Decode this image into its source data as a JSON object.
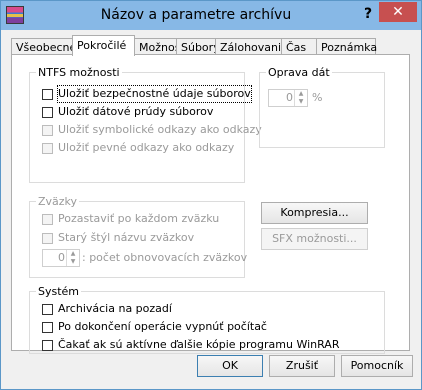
{
  "window": {
    "title": "Názov a parametre archívu",
    "help_glyph": "?",
    "close_glyph": "✕"
  },
  "tabs": [
    {
      "label": "Všeobecné"
    },
    {
      "label": "Pokročilé"
    },
    {
      "label": "Možnosti"
    },
    {
      "label": "Súbory"
    },
    {
      "label": "Zálohovanie"
    },
    {
      "label": "Čas"
    },
    {
      "label": "Poznámka"
    }
  ],
  "ntfs": {
    "title": "NTFS možnosti",
    "options": [
      {
        "label": "Uložiť bezpečnostné údaje súborov",
        "checked": false,
        "enabled": true
      },
      {
        "label": "Uložiť dátové prúdy súborov",
        "checked": false,
        "enabled": true
      },
      {
        "label": "Uložiť symbolické odkazy ako odkazy",
        "checked": false,
        "enabled": false
      },
      {
        "label": "Uložiť pevné odkazy ako odkazy",
        "checked": false,
        "enabled": false
      }
    ]
  },
  "recovery": {
    "title": "Oprava dát",
    "value": "0",
    "unit": "%"
  },
  "volumes": {
    "title": "Zväzky",
    "options": [
      {
        "label": "Pozastaviť po každom zväzku",
        "checked": false,
        "enabled": false
      },
      {
        "label": "Starý štýl názvu zväzkov",
        "checked": false,
        "enabled": false
      }
    ],
    "recovery_volumes_value": "0",
    "recovery_volumes_label": ": počet obnovovacích zväzkov"
  },
  "buttons": {
    "compression": "Kompresia...",
    "sfx_options": "SFX možnosti...",
    "ok": "OK",
    "cancel": "Zrušiť",
    "help": "Pomocník"
  },
  "system": {
    "title": "Systém",
    "options": [
      {
        "label": "Archivácia na pozadí",
        "checked": false
      },
      {
        "label": "Po dokončení operácie vypnúť počítač",
        "checked": false
      },
      {
        "label": "Čakať ak sú aktívne ďalšie kópie programu WinRAR",
        "checked": false
      }
    ]
  }
}
